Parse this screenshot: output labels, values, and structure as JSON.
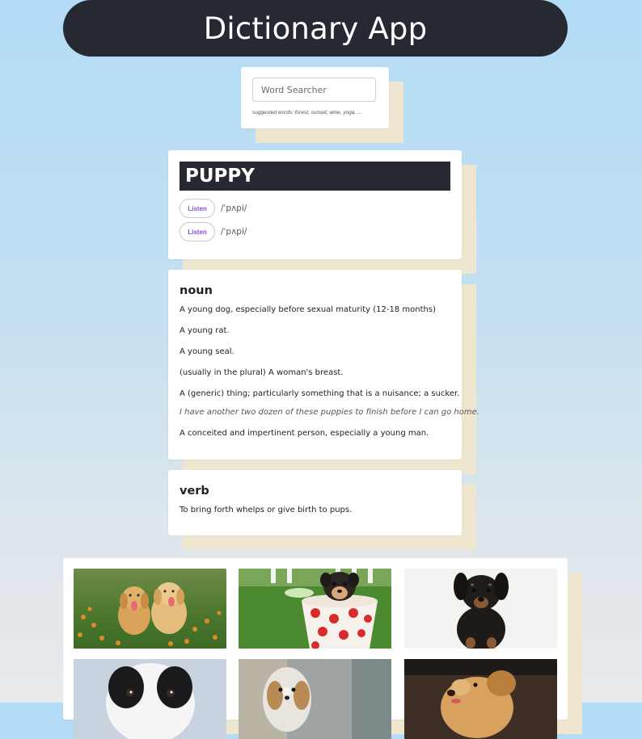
{
  "app": {
    "title": "Dictionary App"
  },
  "search": {
    "placeholder": "Word Searcher",
    "value": "",
    "suggestions": "suggested words: forest, sunset, wine, yoga, ..."
  },
  "word": {
    "title": "PUPPY",
    "phonetics": [
      {
        "listen_label": "Listen",
        "text": "/ˈpʌpi/"
      },
      {
        "listen_label": "Listen",
        "text": "/ˈpʌpi/"
      }
    ]
  },
  "meanings": [
    {
      "part_of_speech": "noun",
      "definitions": [
        "A young dog, especially before sexual maturity (12-18 months)",
        "A young rat.",
        "A young seal.",
        "(usually in the plural) A woman's breast.",
        "A (generic) thing; particularly something that is a nuisance; a sucker.",
        "A conceited and impertinent person, especially a young man."
      ],
      "example": "I have another two dozen of these puppies to finish before I can go home."
    },
    {
      "part_of_speech": "verb",
      "definitions": [
        "To bring forth whelps or give birth to pups."
      ]
    }
  ],
  "gallery": {
    "images": [
      {
        "name": "two-golden-retriever-puppies-image"
      },
      {
        "name": "puppy-in-polka-dot-cup-image"
      },
      {
        "name": "black-puppy-image"
      },
      {
        "name": "black-white-puppy-image"
      },
      {
        "name": "shih-tzu-puppy-image"
      },
      {
        "name": "golden-puppy-image"
      }
    ]
  },
  "colors": {
    "header_bg": "#272932",
    "card_shadow": "#efe6d0",
    "listen_text": "#8a4fcf",
    "background_top": "#b3dcf6"
  }
}
